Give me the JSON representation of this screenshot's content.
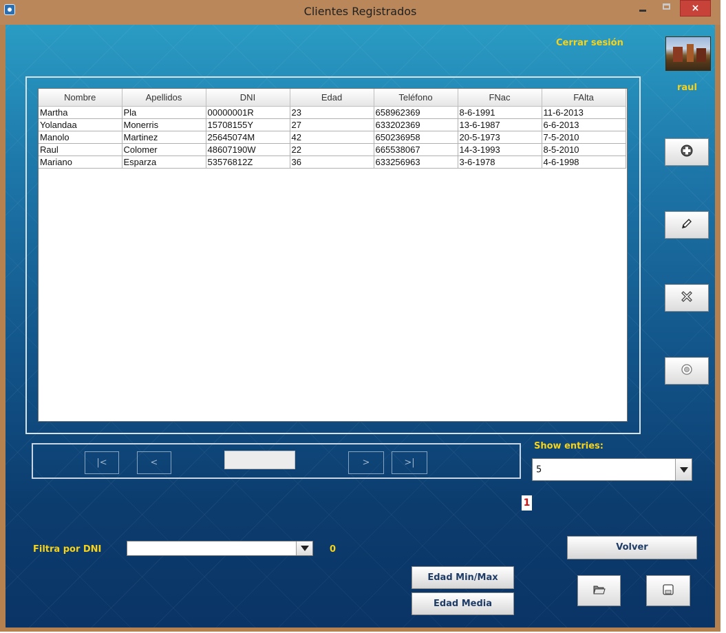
{
  "window": {
    "title": "Clientes Registrados",
    "close_label": "×"
  },
  "header": {
    "logout_label": "Cerrar sesión",
    "username": "raul"
  },
  "table": {
    "columns": [
      "Nombre",
      "Apellidos",
      "DNI",
      "Edad",
      "Teléfono",
      "FNac",
      "FAlta"
    ],
    "rows": [
      [
        "Martha",
        "Pla",
        "00000001R",
        "23",
        "658962369",
        "8-6-1991",
        "11-6-2013"
      ],
      [
        "Yolandaa",
        "Monerris",
        "15708155Y",
        "27",
        "633202369",
        "13-6-1987",
        "6-6-2013"
      ],
      [
        "Manolo",
        "Martinez",
        "25645074M",
        "42",
        "650236958",
        "20-5-1973",
        "7-5-2010"
      ],
      [
        "Raul",
        "Colomer",
        "48607190W",
        "22",
        "665538067",
        "14-3-1993",
        "8-5-2010"
      ],
      [
        "Mariano",
        "Esparza",
        "53576812Z",
        "36",
        "633256963",
        "3-6-1978",
        "4-6-1998"
      ]
    ]
  },
  "sidebar": {
    "add": "plus-icon",
    "edit": "pencil-icon",
    "delete": "x-icon",
    "info": "info-icon"
  },
  "pager": {
    "first_label": "|<",
    "prev_label": "<",
    "next_label": ">",
    "last_label": ">|",
    "current_page": "1"
  },
  "entries": {
    "label": "Show entries:",
    "selected": "5"
  },
  "filter": {
    "label": "Filtra por DNI",
    "value": "",
    "count": "0"
  },
  "buttons": {
    "volver": "Volver",
    "edad_min_max": "Edad Min/Max",
    "edad_media": "Edad Media"
  },
  "colors": {
    "accent_yellow": "#f7d319",
    "page_number": "#d11111",
    "button_text": "#1e3c66"
  }
}
